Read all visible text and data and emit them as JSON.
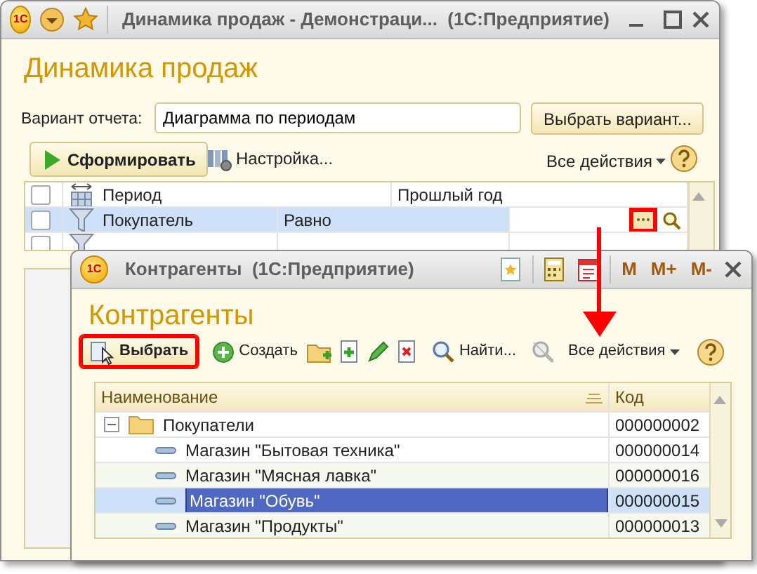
{
  "main_window": {
    "logo": "1С",
    "title": "Динамика продаж - Демонстраци...",
    "app": "(1С:Предприятие)",
    "heading": "Динамика продаж",
    "variant_label": "Вариант отчета:",
    "variant_value": "Диаграмма по периодам",
    "choose_variant_button": "Выбрать вариант...",
    "toolbar": {
      "generate_button": "Сформировать",
      "settings_button": "Настройка...",
      "all_actions": "Все действия"
    },
    "settings_rows": [
      {
        "kind": "period",
        "checked": false,
        "selected": false,
        "field": "Период",
        "value": "Прошлый год"
      },
      {
        "kind": "filter",
        "checked": false,
        "selected": true,
        "field": "Покупатель",
        "condition": "Равно",
        "choice_highlighted": true
      },
      {
        "kind": "filter",
        "checked": false,
        "selected": false
      }
    ]
  },
  "dialog": {
    "logo": "1С",
    "title": "Контрагенты",
    "app": "(1С:Предприятие)",
    "memory_buttons": [
      "M",
      "M+",
      "M-"
    ],
    "heading": "Контрагенты",
    "toolbar": {
      "select_button": "Выбрать",
      "select_highlighted": true,
      "create_button": "Создать",
      "find_button": "Найти...",
      "all_actions": "Все действия"
    },
    "columns": [
      "Наименование",
      "Код"
    ],
    "rows": [
      {
        "kind": "folder",
        "expanded": true,
        "selected": false,
        "name": "Покупатели",
        "code": "000000002",
        "children": [
          {
            "kind": "item",
            "selected": false,
            "name": "Магазин \"Бытовая техника\"",
            "code": "000000014"
          },
          {
            "kind": "item",
            "selected": false,
            "name": "Магазин \"Мясная лавка\"",
            "code": "000000016"
          },
          {
            "kind": "item",
            "selected": true,
            "name": "Магазин \"Обувь\"",
            "code": "000000015"
          },
          {
            "kind": "item",
            "selected": false,
            "name": "Магазин \"Продукты\"",
            "code": "000000013"
          }
        ]
      }
    ]
  }
}
